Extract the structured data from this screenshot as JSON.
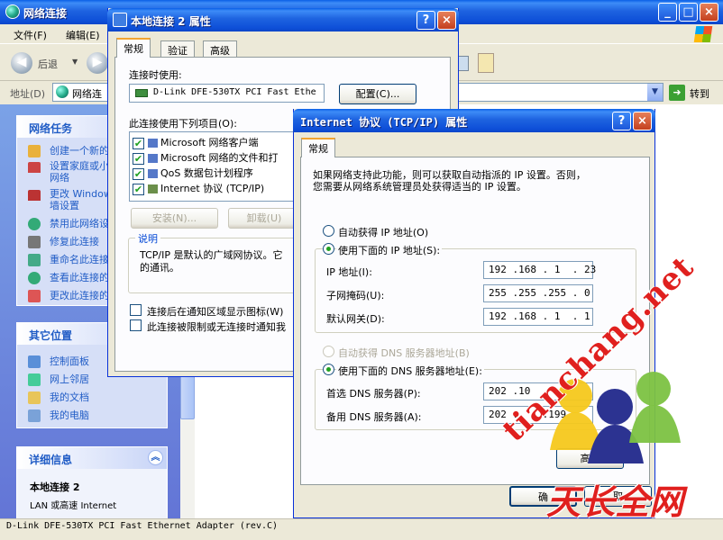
{
  "explorer": {
    "title": "网络连接",
    "menu": [
      "文件(F)",
      "编辑(E)"
    ],
    "back_label": "后退",
    "address_label": "地址(D)",
    "address_value": "网络连",
    "go_label": "转到",
    "status_text": "D-Link DFE-530TX PCI Fast Ethernet Adapter (rev.C)",
    "network_tasks": {
      "title": "网络任务",
      "items": [
        {
          "label": "创建一个新的",
          "icon": "new-connection-icon"
        },
        {
          "label": "设置家庭或小",
          "icon": "home-network-icon"
        },
        {
          "label": "网络",
          "icon": ""
        },
        {
          "label": "更改 Windows",
          "icon": "firewall-icon"
        },
        {
          "label": "墙设置",
          "icon": ""
        },
        {
          "label": "禁用此网络设",
          "icon": "disable-network-icon"
        },
        {
          "label": "修复此连接",
          "icon": "repair-icon"
        },
        {
          "label": "重命名此连接",
          "icon": "rename-icon"
        },
        {
          "label": "查看此连接的",
          "icon": "status-icon"
        },
        {
          "label": "更改此连接的",
          "icon": "settings-icon"
        }
      ]
    },
    "other_places": {
      "title": "其它位置",
      "items": [
        {
          "label": "控制面板",
          "icon": "control-panel-icon"
        },
        {
          "label": "网上邻居",
          "icon": "network-places-icon"
        },
        {
          "label": "我的文档",
          "icon": "my-documents-icon"
        },
        {
          "label": "我的电脑",
          "icon": "my-computer-icon"
        }
      ]
    },
    "details": {
      "title": "详细信息",
      "name": "本地连接 2",
      "line1": "LAN 或高速 Internet"
    }
  },
  "conn_props": {
    "title": "本地连接 2 属性",
    "tabs": [
      "常规",
      "验证",
      "高级"
    ],
    "connect_using_label": "连接时使用:",
    "adapter_name": "D-Link DFE-530TX PCI Fast Ethe",
    "configure_label": "配置(C)...",
    "items_label": "此连接使用下列项目(O):",
    "items": [
      {
        "label": "Microsoft 网络客户端",
        "checked": true
      },
      {
        "label": "Microsoft 网络的文件和打",
        "checked": true
      },
      {
        "label": "QoS 数据包计划程序",
        "checked": true
      },
      {
        "label": "Internet 协议 (TCP/IP)",
        "checked": true
      }
    ],
    "install_label": "安装(N)...",
    "uninstall_label": "卸载(U)",
    "desc_title": "说明",
    "desc_text_1": "TCP/IP 是默认的广域网协议。它",
    "desc_text_2": "的通讯。",
    "show_icon_label": "连接后在通知区域显示图标(W)",
    "notify_label": "此连接被限制或无连接时通知我"
  },
  "tcpip": {
    "title": "Internet 协议 (TCP/IP) 属性",
    "tab": "常规",
    "intro_1": "如果网络支持此功能，则可以获取自动指派的 IP 设置。否则，",
    "intro_2": "您需要从网络系统管理员处获得适当的 IP 设置。",
    "auto_ip_label": "自动获得 IP 地址(O)",
    "manual_ip_label": "使用下面的 IP 地址(S):",
    "ip_label": "IP 地址(I):",
    "ip_value": "192 .168 . 1  . 23",
    "mask_label": "子网掩码(U):",
    "mask_value": "255 .255 .255 . 0",
    "gateway_label": "默认网关(D):",
    "gateway_value": "192 .168 . 1  . 1",
    "auto_dns_label": "自动获得 DNS 服务器地址(B)",
    "manual_dns_label": "使用下面的 DNS 服务器地址(E):",
    "dns1_label": "首选 DNS 服务器(P):",
    "dns1_value": "202 .10",
    "dns2_label": "备用 DNS 服务器(A):",
    "dns2_value": "202 .    .199",
    "advanced_label": "高级",
    "ok_label": "确",
    "cancel_label": "取"
  },
  "watermark": {
    "url_text": "tianchang.net",
    "brand_text": "天长全网"
  },
  "colors": {
    "xp_blue": "#0A5FE6",
    "face": "#ECE9D8",
    "link_blue": "#215DC6",
    "watermark_red": "#E0201E"
  }
}
